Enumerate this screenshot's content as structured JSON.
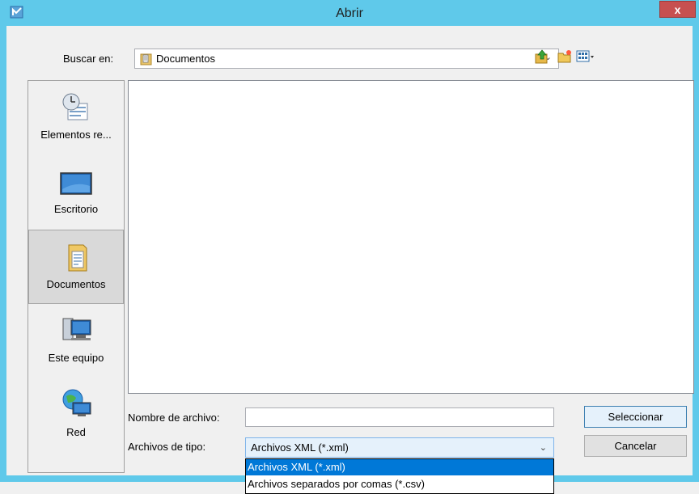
{
  "window": {
    "title": "Abrir",
    "close_label": "x"
  },
  "toolbar": {
    "lookin_label": "Buscar en:",
    "lookin_value": "Documentos",
    "icons": [
      "up-folder-icon",
      "new-folder-icon",
      "view-menu-icon"
    ]
  },
  "places": [
    {
      "label": "Elementos re...",
      "icon": "recent-items-icon",
      "selected": false
    },
    {
      "label": "Escritorio",
      "icon": "desktop-icon",
      "selected": false
    },
    {
      "label": "Documentos",
      "icon": "documents-folder-icon",
      "selected": true
    },
    {
      "label": "Este equipo",
      "icon": "computer-icon",
      "selected": false
    },
    {
      "label": "Red",
      "icon": "network-icon",
      "selected": false
    }
  ],
  "form": {
    "filename_label": "Nombre de archivo:",
    "filename_value": "",
    "filetype_label": "Archivos de tipo:",
    "filetype_value": "Archivos XML (*.xml)"
  },
  "buttons": {
    "select": "Seleccionar",
    "cancel": "Cancelar"
  },
  "dropdown": {
    "options": [
      {
        "label": "Archivos XML (*.xml)",
        "selected": true
      },
      {
        "label": "Archivos separados por comas (*.csv)",
        "selected": false
      }
    ]
  },
  "colors": {
    "titlebar": "#5fc9ea",
    "close_button": "#c75050",
    "selection": "#0078d7"
  }
}
